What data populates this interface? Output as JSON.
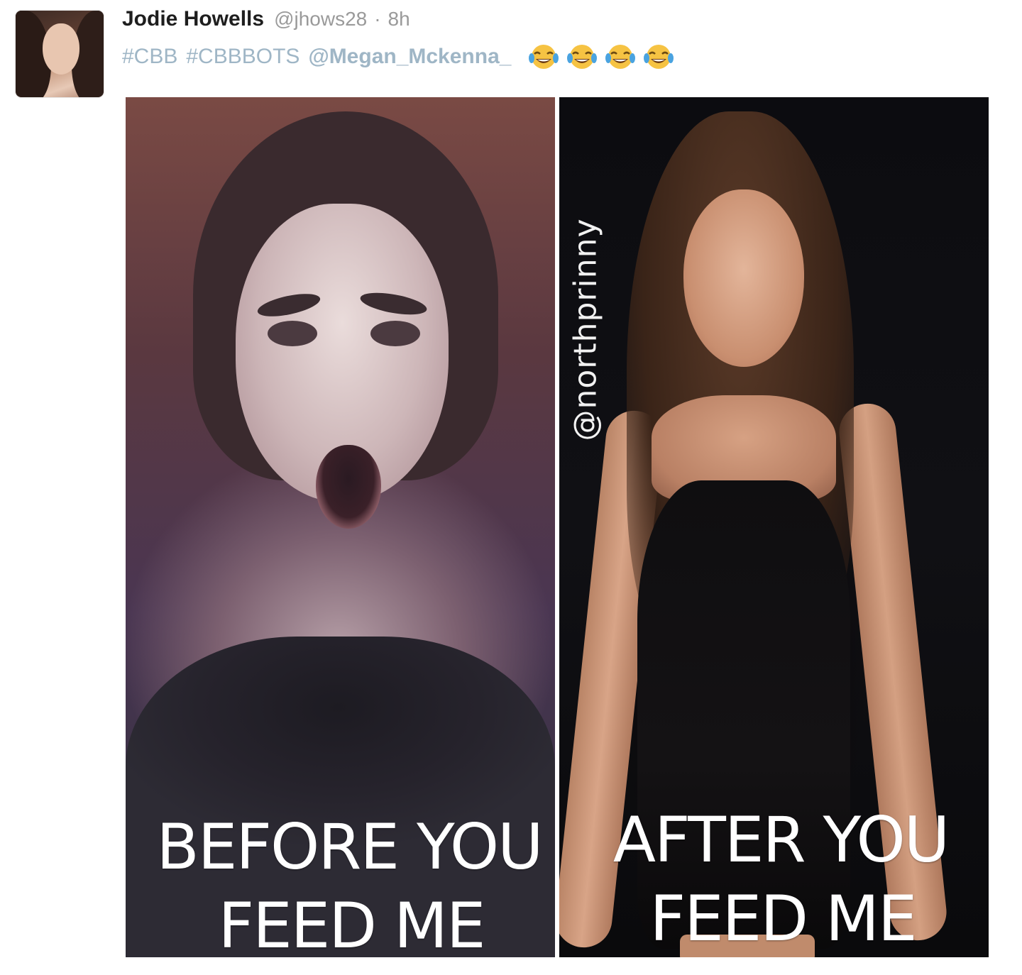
{
  "tweet": {
    "author": {
      "name": "Jodie Howells",
      "handle": "@jhows28",
      "separator": "·",
      "time": "8h"
    },
    "text": {
      "hashtags": [
        "#CBB",
        "#CBBBOTS"
      ],
      "mention": "@Megan_Mckenna_",
      "emojis": [
        "face-with-tears-of-joy",
        "face-with-tears-of-joy",
        "face-with-tears-of-joy",
        "face-with-tears-of-joy"
      ]
    },
    "media": {
      "watermark": "@northprinny",
      "left_caption": {
        "line1": "BEFORE YOU",
        "line2": "FEED ME"
      },
      "right_caption": {
        "line1": "AFTER YOU",
        "line2": "FEED ME"
      }
    }
  },
  "colors": {
    "name": "#1e1e1e",
    "meta": "#9a9a9a",
    "link": "#9fb6c6",
    "caption": "#ffffff",
    "emoji_face": "#f6c343",
    "emoji_tears": "#4aa3e0"
  }
}
